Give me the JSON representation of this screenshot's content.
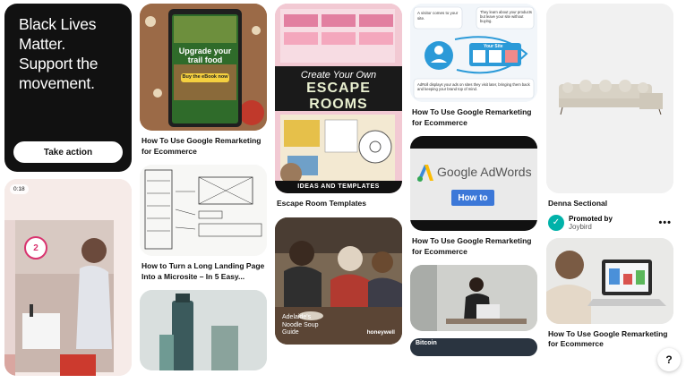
{
  "blm_card": {
    "headline": "Black Lives Matter. Support the movement.",
    "button": "Take action"
  },
  "video_pin": {
    "duration": "0:18",
    "step": "2"
  },
  "pin_ebook": {
    "title": "Upgrade your trail food",
    "button": "Buy the eBook now",
    "caption": "How To Use Google Remarketing for Ecommerce"
  },
  "pin_wireframe": {
    "caption": "How to Turn a Long Landing Page Into a Microsite – In 5 Easy..."
  },
  "pin_escape": {
    "line1": "Create Your Own",
    "line2": "ESCAPE ROOMS",
    "footer": "IDEAS AND TEMPLATES",
    "caption": "Escape Room Templates"
  },
  "pin_noodle": {
    "overlay": "Adelaide's Noodle Soup Guide",
    "brand": "honeywell",
    "caption": ""
  },
  "pin_remarketing_diagram": {
    "label_top_left": "A visitor comes to your site.",
    "label_top_right": "They learn about your products but leave your site without buying.",
    "label_site": "Your Site",
    "label_bottom": "AdRoll displays your ads on sites they visit later, bringing them back and keeping your brand top of mind.",
    "caption": "How To Use Google Remarketing for Ecommerce"
  },
  "pin_adwords": {
    "brand": "Google AdWords",
    "button": "How to",
    "caption": "How To Use Google Remarketing for Ecommerce"
  },
  "pin_bitcoin": {
    "label": "Bitcoin"
  },
  "pin_sofa": {
    "caption": "Denna Sectional",
    "promoted_by": "Promoted by",
    "advertiser": "Joybird"
  },
  "pin_laptop": {
    "caption": "How To Use Google Remarketing for Ecommerce"
  },
  "help_label": "?"
}
